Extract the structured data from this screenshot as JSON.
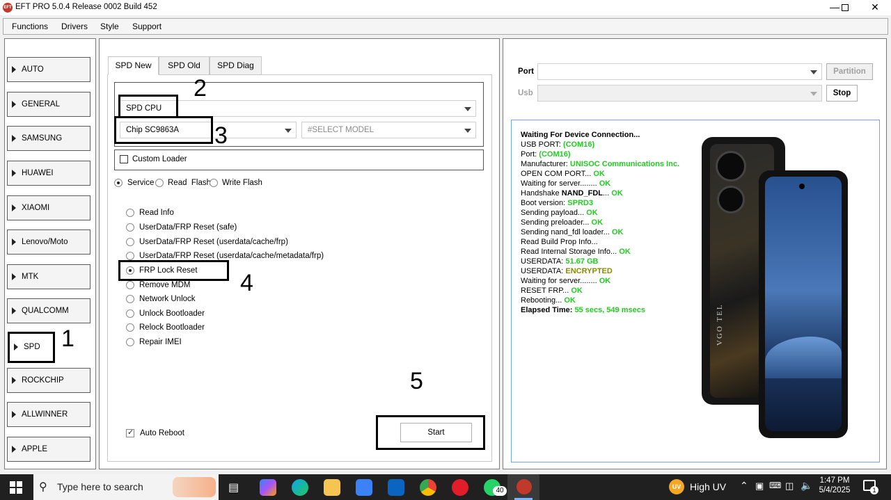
{
  "window": {
    "title": "EFT PRO 5.0.4 Release 0002 Build 452",
    "app_icon_text": "EFT"
  },
  "menu": [
    "Functions",
    "Drivers",
    "Style",
    "Support"
  ],
  "sidebar": [
    "AUTO",
    "GENERAL",
    "SAMSUNG",
    "HUAWEI",
    "XIAOMI",
    "Lenovo/Moto",
    "MTK",
    "QUALCOMM",
    "SPD",
    "ROCKCHIP",
    "ALLWINNER",
    "APPLE"
  ],
  "tabs": [
    "SPD New",
    "SPD Old",
    "SPD Diag"
  ],
  "cpu_combo": "SPD CPU",
  "chip_combo": "Chip SC9863A",
  "model_combo_placeholder": "#SELECT MODEL",
  "custom_loader": "Custom Loader",
  "modes": [
    "Service",
    "Read  Flash",
    "Write Flash"
  ],
  "operations": [
    "Read Info",
    "UserData/FRP Reset (safe)",
    "UserData/FRP Reset (userdata/cache/frp)",
    "UserData/FRP Reset (userdata/cache/metadata/frp)",
    "FRP Lock Reset",
    "Remove MDM",
    "Network Unlock",
    "Unlock Bootloader",
    "Relock Bootloader",
    "Repair IMEI"
  ],
  "auto_reboot": "Auto Reboot",
  "start_button": "Start",
  "annotations": [
    "1",
    "2",
    "3",
    "4",
    "5"
  ],
  "port_label": "Port",
  "usb_label": "Usb",
  "partition_button": "Partition",
  "stop_button": "Stop",
  "log": {
    "l1": "Waiting For Device Connection...",
    "l2a": "USB PORT: ",
    "l2b": "(COM16)",
    "l3a": "Port: ",
    "l3b": "(COM16)",
    "l4a": "Manufacturer: ",
    "l4b": "UNISOC Communications Inc.",
    "l5a": "OPEN COM PORT... ",
    "l5b": "OK",
    "l6a": "Waiting for server........ ",
    "l6b": "OK",
    "l7a": "Handshake ",
    "l7c": "NAND_FDL",
    "l7d": "... ",
    "l7b": "OK",
    "l8a": "Boot version: ",
    "l8b": "SPRD3",
    "l9a": "Sending payload... ",
    "l9b": "OK",
    "l10a": "Sending preloader... ",
    "l10b": "OK",
    "l11a": "Sending nand_fdl loader... ",
    "l11b": "OK",
    "l12a": "Read Build Prop Info...",
    "l13a": "Read Internal Storage Info... ",
    "l13b": "OK",
    "l14a": "USERDATA: ",
    "l14b": "51.67 GB",
    "l15a": "USERDATA: ",
    "l15b": "ENCRYPTED",
    "l16a": "Waiting for server........ ",
    "l16b": "OK",
    "l17a": "RESET FRP... ",
    "l17b": "OK",
    "l18a": "Rebooting... ",
    "l18b": "OK",
    "l19a": "Elapsed Time: ",
    "l19b": "55 secs, 549 msecs"
  },
  "phone_brand": "VGO TEL",
  "taskbar": {
    "search_placeholder": "Type here to search",
    "weather_badge": "UV",
    "weather_text": "High UV",
    "time": "1:47 PM",
    "date": "5/4/2025",
    "whatsapp_badge": "40",
    "notification_count": "1"
  }
}
